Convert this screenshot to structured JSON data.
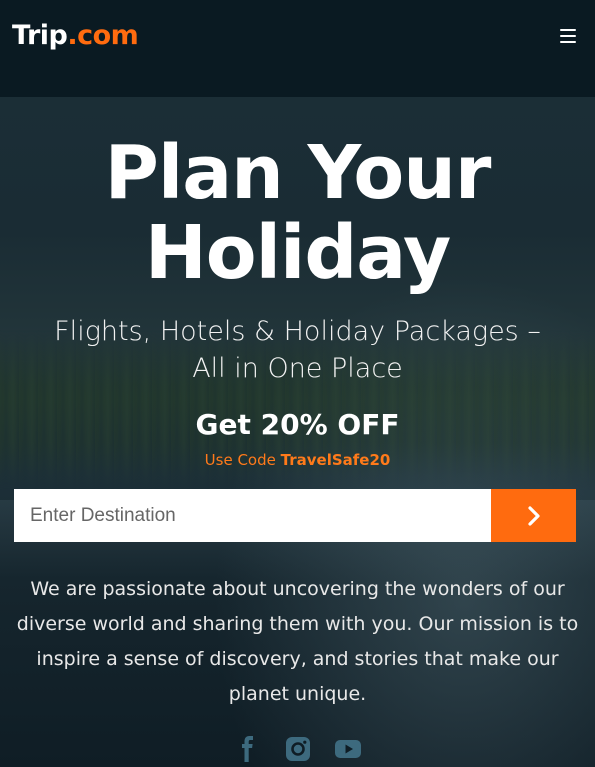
{
  "header": {
    "brand": "Trip",
    "brand_tld": ".com",
    "menu_icon": "hamburger-menu-icon"
  },
  "hero": {
    "title_line1": "Plan Your",
    "title_line2": "Holiday",
    "subtitle_line1": "Flights, Hotels & Holiday Packages –",
    "subtitle_line2": "All in One Place",
    "offer": "Get 20% OFF",
    "promo_prefix": "Use Code",
    "promo_code": "TravelSafe20"
  },
  "search": {
    "placeholder": "Enter Destination",
    "button_icon": "chevron-right-icon"
  },
  "about": {
    "text": "We are passionate about uncovering the wonders of our diverse world and sharing them with you. Our mission is to inspire a sense of discovery, and stories that make our planet unique."
  },
  "socials": [
    "facebook-icon",
    "instagram-icon",
    "youtube-icon"
  ],
  "colors": {
    "accent": "#ff6b0f",
    "header_bg": "#0a1a22",
    "social_icon": "#3d6a7e"
  }
}
